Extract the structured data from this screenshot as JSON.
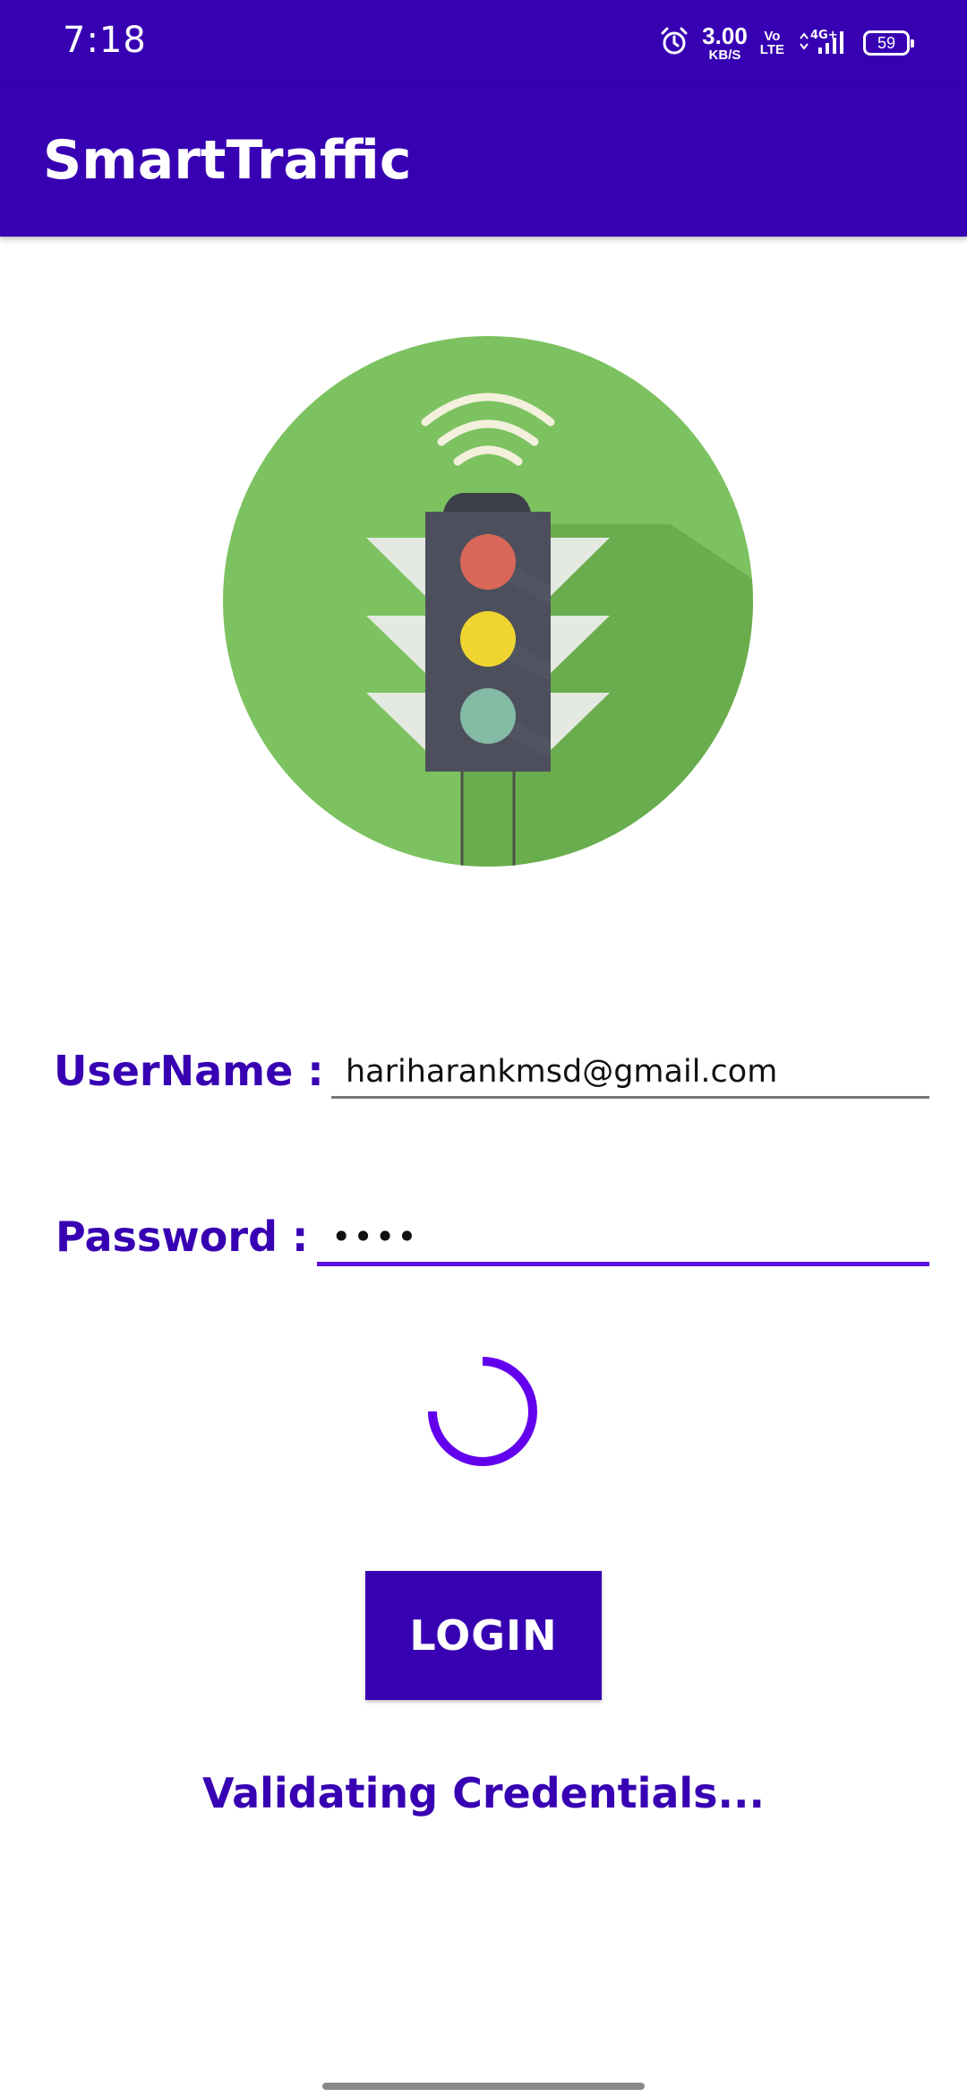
{
  "status_bar": {
    "time": "7:18",
    "net_speed_value": "3.00",
    "net_speed_unit": "KB/S",
    "volte_top": "Vo",
    "volte_bottom": "LTE",
    "network_label": "4G+",
    "battery": "59",
    "icons": [
      "alarm-icon",
      "volte-icon",
      "signal-icon",
      "battery-icon"
    ]
  },
  "app_bar": {
    "title": "SmartTraffic"
  },
  "logo": {
    "icon": "traffic-light-icon",
    "colors": {
      "circle": "#7cc260",
      "red_light": "#d9675a",
      "yellow_light": "#f0d530",
      "green_light": "#83bba5"
    }
  },
  "form": {
    "username_label": "UserName :",
    "username_value": "hariharankmsd@gmail.com",
    "password_label": "Password :",
    "password_value": "••••",
    "login_label": "LOGIN",
    "status_message": "Validating Credentials..."
  },
  "theme": {
    "primary": "#3700b3",
    "accent": "#6200ee"
  }
}
